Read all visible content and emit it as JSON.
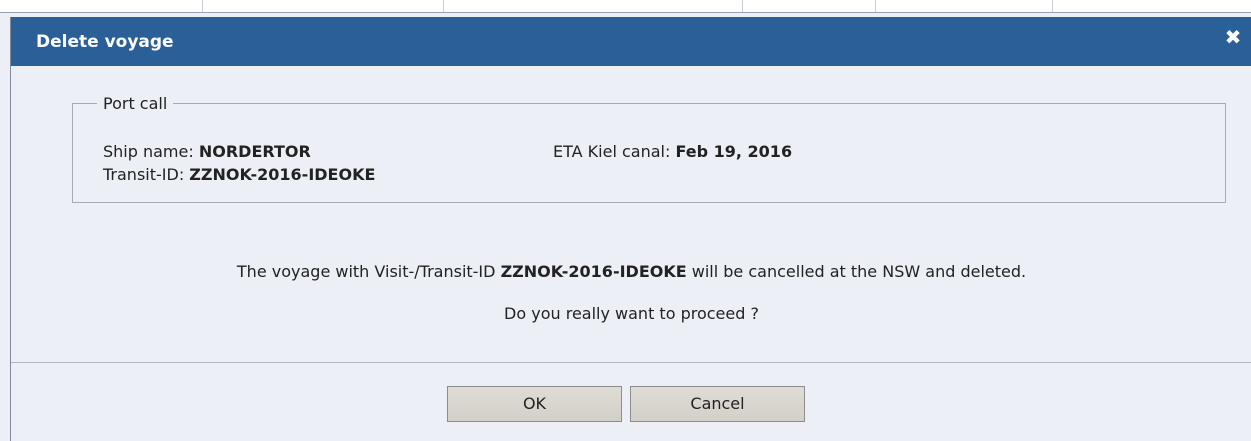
{
  "dialog": {
    "title": "Delete voyage",
    "close_icon": "close-icon"
  },
  "port_call": {
    "legend": "Port call",
    "ship_name_label": "Ship name:",
    "ship_name_value": "NORDERTOR",
    "eta_label": "ETA Kiel canal:",
    "eta_value": "Feb 19, 2016",
    "transit_id_label": "Transit-ID:",
    "transit_id_value": "ZZNOK-2016-IDEOKE"
  },
  "message": {
    "line1_prefix": "The voyage with Visit-/Transit-ID",
    "line1_id": "ZZNOK-2016-IDEOKE",
    "line1_suffix": "will be cancelled at the NSW and deleted.",
    "line2": "Do you really want to proceed ?"
  },
  "buttons": {
    "ok_label": "OK",
    "cancel_label": "Cancel"
  },
  "colors": {
    "titlebar": "#2a5f98",
    "dialog_bg": "#eceff6",
    "button_bg": "#d8d4ce"
  }
}
